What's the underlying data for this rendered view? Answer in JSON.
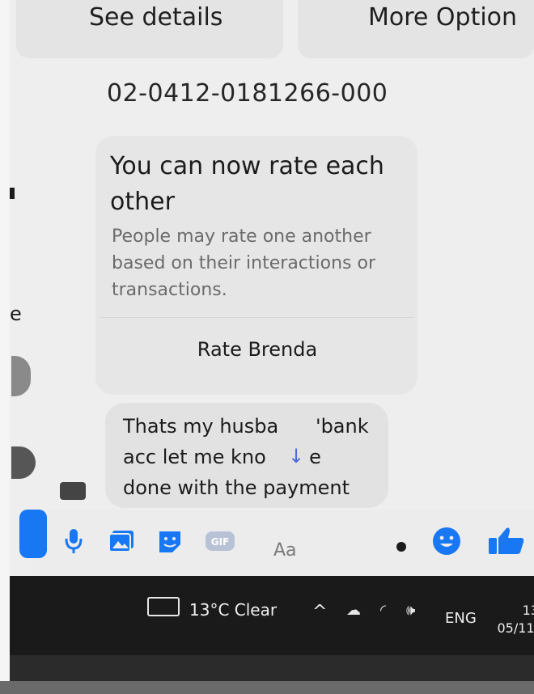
{
  "header": {
    "see_details": "See details",
    "more_options": "More Option"
  },
  "account_number": "02-0412-0181266-000",
  "rating_card": {
    "title": "You can now rate each other",
    "subtitle": "People may rate one another based on their interactions or transactions.",
    "rate_button": "Rate Brenda"
  },
  "message": {
    "text_line1": "Thats my husba      'bank",
    "text_line2": "acc let me kno       e",
    "text_line3": "done with the payment"
  },
  "composer": {
    "placeholder": "Aa",
    "icons": [
      "microphone-icon",
      "photo-icon",
      "sticker-icon",
      "gif-icon",
      "emoji-icon",
      "like-icon"
    ],
    "gif_label": "GIF",
    "accent_color": "#1877f2"
  },
  "taskbar": {
    "weather": "13°C  Clear",
    "language": "ENG",
    "time": "13",
    "date": "05/11/"
  }
}
